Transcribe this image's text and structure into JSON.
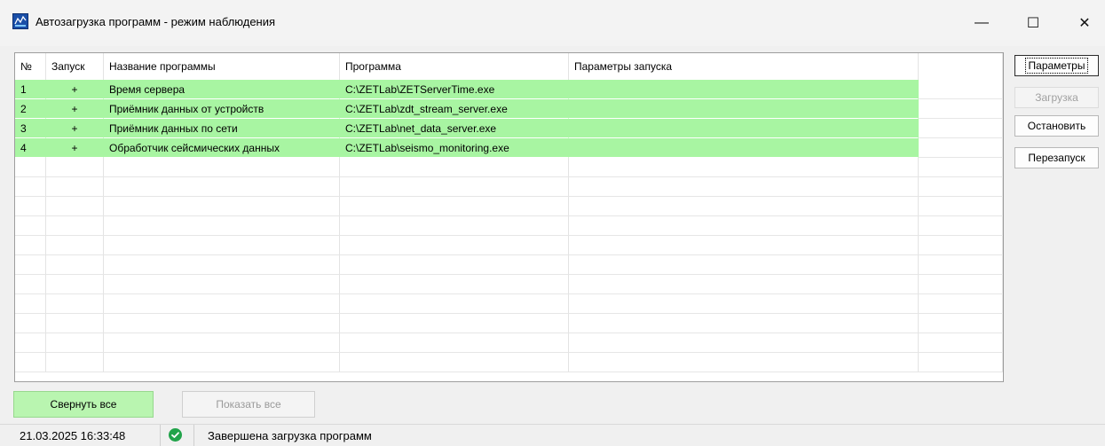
{
  "window": {
    "title": "Автозагрузка программ - режим наблюдения",
    "icon": "app-logo-icon",
    "controls": {
      "minimize": "—",
      "maximize": "☐",
      "close": "✕"
    }
  },
  "table": {
    "columns": [
      "№",
      "Запуск",
      "Название программы",
      "Программа",
      "Параметры запуска"
    ],
    "rows": [
      {
        "num": "1",
        "launch": "+",
        "name": "Время сервера",
        "program": "C:\\ZETLab\\ZETServerTime.exe",
        "params": ""
      },
      {
        "num": "2",
        "launch": "+",
        "name": "Приёмник данных от устройств",
        "program": "C:\\ZETLab\\zdt_stream_server.exe",
        "params": ""
      },
      {
        "num": "3",
        "launch": "+",
        "name": "Приёмник данных по сети",
        "program": "C:\\ZETLab\\net_data_server.exe",
        "params": ""
      },
      {
        "num": "4",
        "launch": "+",
        "name": "Обработчик сейсмических данных",
        "program": "C:\\ZETLab\\seismo_monitoring.exe",
        "params": ""
      }
    ],
    "row_highlight_color": "#a8f5a2"
  },
  "side_buttons": {
    "params": "Параметры",
    "load": "Загрузка",
    "stop": "Остановить",
    "restart": "Перезапуск"
  },
  "bottom_buttons": {
    "collapse_all": "Свернуть все",
    "show_all": "Показать все"
  },
  "status": {
    "datetime": "21.03.2025 16:33:48",
    "icon": "check-circle-icon",
    "message": "Завершена загрузка программ",
    "ok_color": "#21a34a"
  }
}
